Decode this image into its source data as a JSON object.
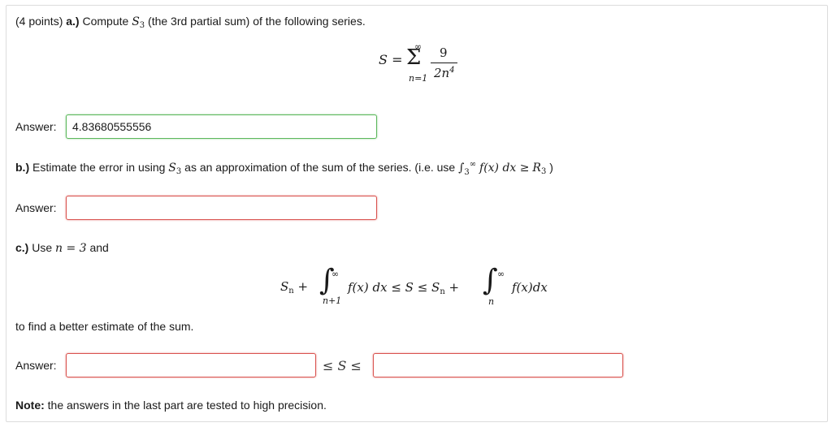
{
  "part_a": {
    "points": "(4 points)",
    "label": "a.)",
    "text_1": "Compute",
    "text_2": "(the 3rd partial sum) of the following series.",
    "formula": {
      "lhs": "S",
      "eq": "=",
      "sigma": "Σ",
      "upper": "∞",
      "lower": "n=1",
      "numerator": "9",
      "denominator_base": "2n",
      "denominator_exp": "4"
    }
  },
  "answer_label": "Answer:",
  "answer_a": {
    "value": "4.83680555556",
    "status": "correct"
  },
  "part_b": {
    "label": "b.)",
    "text_1": "Estimate the error in using",
    "text_2": "as an approximation of the sum of the series. (i.e. use",
    "integral_expr": "f(x) dx ≥",
    "close": ")"
  },
  "answer_b": {
    "value": "",
    "status": "wrong"
  },
  "part_c": {
    "label": "c.)",
    "text_1": "Use",
    "eq": "n = 3",
    "text_2": "and",
    "inequality_left": "f(x) dx ≤ S ≤",
    "inequality_right": "f(x)dx",
    "after": "to find a better estimate of the sum."
  },
  "answer_c": {
    "lower_value": "",
    "upper_value": "",
    "between": "≤ S ≤",
    "status": "wrong"
  },
  "note": {
    "label": "Note:",
    "text": "the answers in the last part are tested to high precision."
  },
  "colors": {
    "correct_border": "#5cb85c",
    "wrong_border": "#d9534f"
  }
}
